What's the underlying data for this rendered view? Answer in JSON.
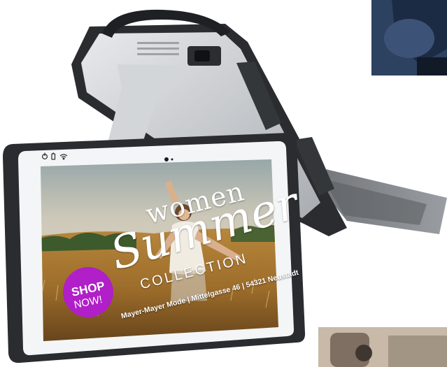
{
  "screen_ad": {
    "headline_top": "women",
    "headline_script": "Summer",
    "headline_bottom": "COLLECTION",
    "badge_line1": "SHOP",
    "badge_line2": "NOW!",
    "footer_address": "Mayer-Mayer Mode | Mittelgasse 46 | 54321 Neustadt"
  },
  "colors": {
    "badge": "#b01fc7",
    "bezel": "#f4f5f6",
    "bumper": "#2a2c2f",
    "shell": "#c9cdd1"
  },
  "icons": [
    "power-icon",
    "battery-icon",
    "wifi-icon",
    "camera-icon"
  ]
}
